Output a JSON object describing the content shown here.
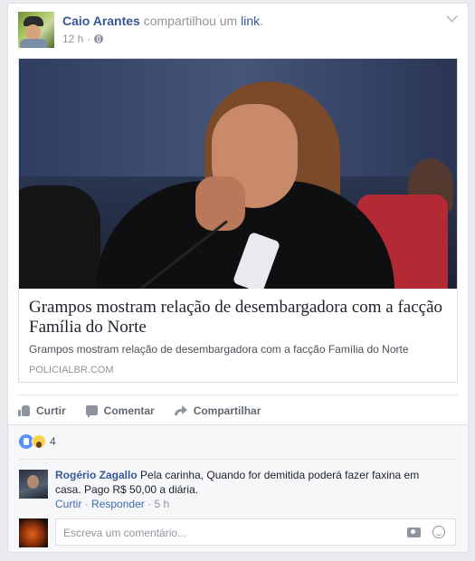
{
  "post": {
    "author": "Caio Arantes",
    "verb": "compartilhou um",
    "link_word": "link",
    "time": "12 h"
  },
  "link_preview": {
    "title": "Grampos mostram relação de desembargadora com a facção Família do Norte",
    "description": "Grampos mostram relação de desembargadora com a facção Família do Norte",
    "domain": "POLICIALBR.COM"
  },
  "actions": {
    "like": "Curtir",
    "comment": "Comentar",
    "share": "Compartilhar"
  },
  "reactions": {
    "count": "4"
  },
  "comment": {
    "author": "Rogério Zagallo",
    "text": "Pela carinha, Quando for demitida poderá fazer faxina em casa. Pago R$ 50,00 a diária.",
    "like_link": "Curtir",
    "reply_link": "Responder",
    "time": "5 h"
  },
  "reply_box": {
    "placeholder": "Escreva um comentário..."
  },
  "colors": {
    "link_blue": "#365899",
    "meta_gray": "#90949c",
    "like_blue": "#5890ff"
  }
}
